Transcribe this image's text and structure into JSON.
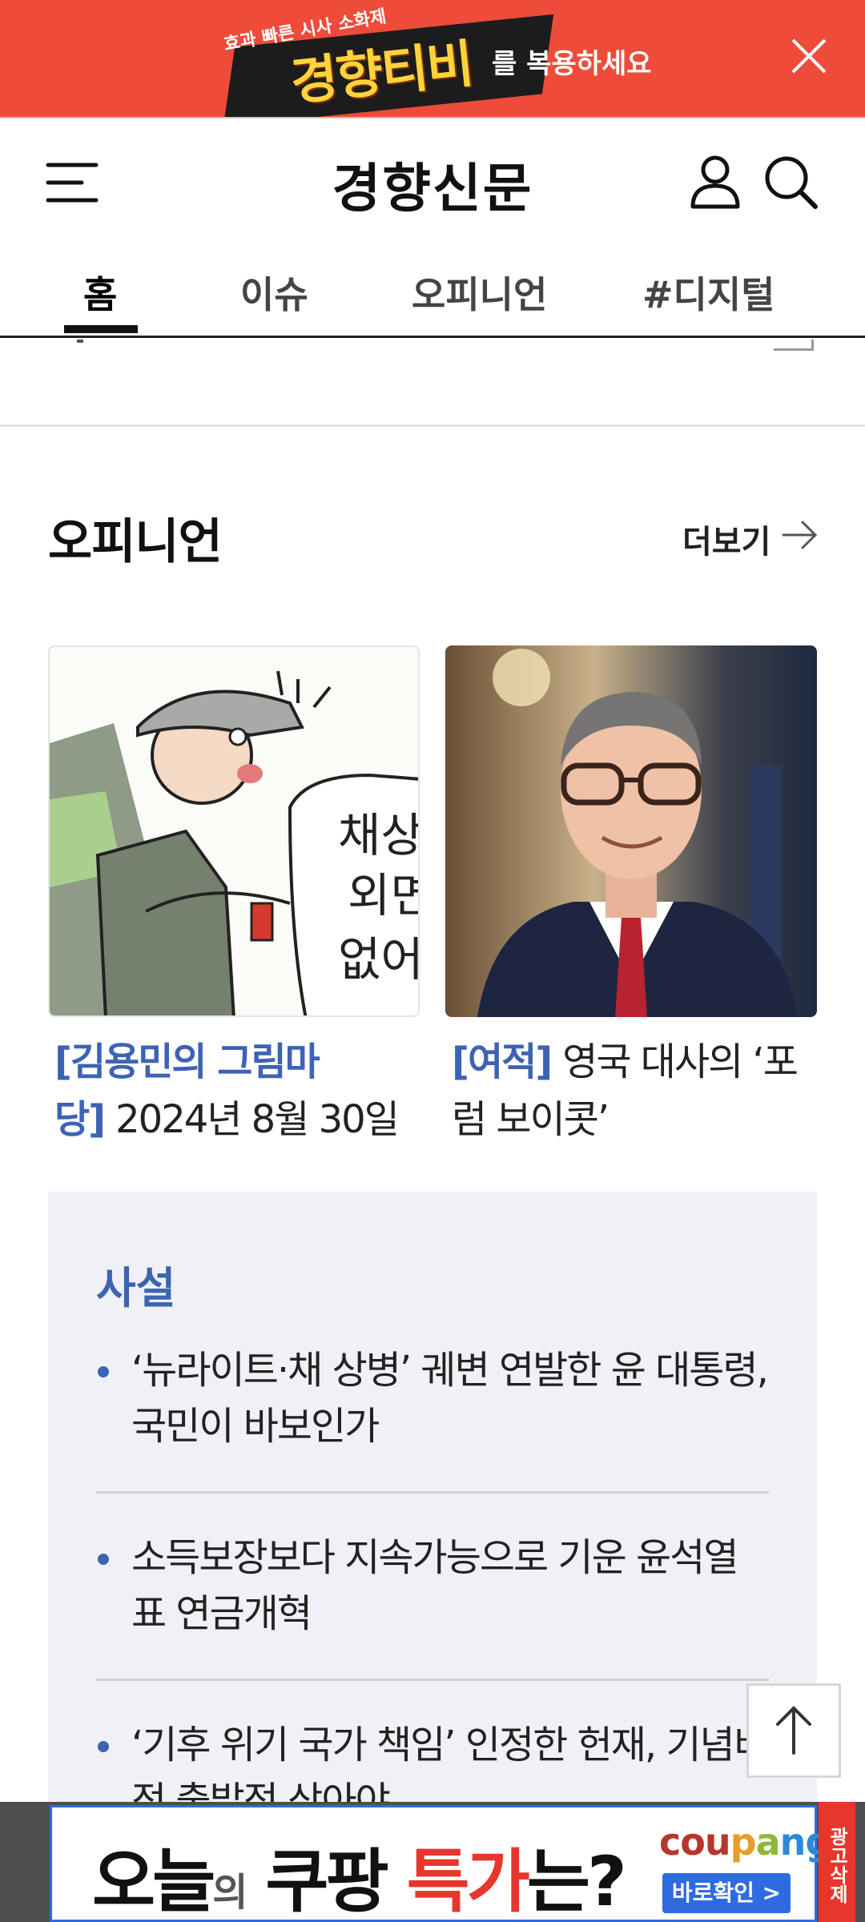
{
  "top_banner": {
    "tagline": "효과 빠른 시사 소화제",
    "brand": "경향티비",
    "suffix": "를 복용하세요",
    "close_icon": "close-icon"
  },
  "header": {
    "menu_icon": "menu-icon",
    "logo": "경향신문",
    "user_icon": "user-icon",
    "search_icon": "search-icon"
  },
  "tabs": [
    {
      "label": "홈",
      "active": true
    },
    {
      "label": "이슈",
      "active": false
    },
    {
      "label": "오피니언",
      "active": false
    },
    {
      "label": "#디지털",
      "active": false
    }
  ],
  "opinion": {
    "title": "오피니언",
    "more_label": "더보기",
    "cards": [
      {
        "tag": "[김용민의 그림마당]",
        "title": "2024년 8월 30일",
        "image": "cartoon-image",
        "cartoon_text": [
          "채상",
          "외면",
          "없어"
        ]
      },
      {
        "tag": "[여적]",
        "title": "영국 대사의 ‘포럼 보이콧’",
        "image": "ambassador-photo"
      }
    ]
  },
  "editorial": {
    "title": "사설",
    "items": [
      "‘뉴라이트·채 상병’ 궤변 연발한 윤 대통령, 국민이 바보인가",
      "소득보장보다 지속가능으로 기운 윤석열표 연금개혁",
      "‘기후 위기 국가 책임’ 인정한 헌재, 기념비적 출발점 삼아야"
    ]
  },
  "scroll_top_icon": "arrow-up-icon",
  "bottom_ad": {
    "headline_1": "오늘",
    "headline_small": "의",
    "headline_2": "쿠팡",
    "headline_red": "특가",
    "headline_3": "는?",
    "brand_parts": [
      "cou",
      "p",
      "a",
      "ng"
    ],
    "cta": "바로확인 >",
    "remove_label": "광고삭제"
  },
  "colors": {
    "banner_bg": "#ee4b3a",
    "accent_blue": "#3c63b4",
    "ad_red": "#e8362c",
    "editorial_bg": "#f0f1f6"
  }
}
